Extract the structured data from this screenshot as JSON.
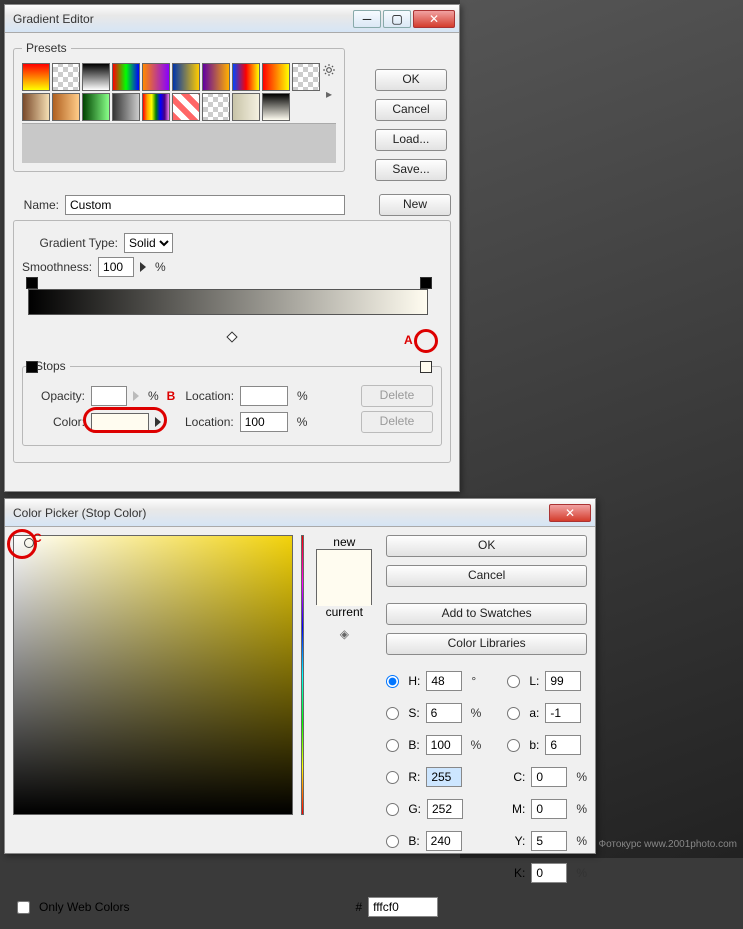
{
  "background_watermark": "Фотокурс   www.2001photo.com",
  "gradient_editor": {
    "title": "Gradient Editor",
    "presets_legend": "Presets",
    "ok": "OK",
    "cancel": "Cancel",
    "load": "Load...",
    "save": "Save...",
    "name_label": "Name:",
    "name_value": "Custom",
    "new_btn": "New",
    "gradient_type_label": "Gradient Type:",
    "gradient_type_value": "Solid",
    "smoothness_label": "Smoothness:",
    "smoothness_value": "100",
    "percent": "%",
    "stops_legend": "Stops",
    "opacity_label": "Opacity:",
    "opacity_value": "",
    "location_label": "Location:",
    "opacity_location_value": "",
    "color_label": "Color:",
    "color_swatch": "#fffcf0",
    "color_location_value": "100",
    "delete": "Delete",
    "annot_A": "A",
    "annot_B": "B"
  },
  "color_picker": {
    "title": "Color Picker (Stop Color)",
    "ok": "OK",
    "cancel": "Cancel",
    "add_to_swatches": "Add to Swatches",
    "color_libraries": "Color Libraries",
    "new_label": "new",
    "current_label": "current",
    "new_color": "#fffcf0",
    "current_color": "#fffcf0",
    "only_web": "Only Web Colors",
    "H_label": "H:",
    "H_value": "48",
    "H_unit": "°",
    "S_label": "S:",
    "S_value": "6",
    "S_unit": "%",
    "Bhsb_label": "B:",
    "Bhsb_value": "100",
    "Bhsb_unit": "%",
    "R_label": "R:",
    "R_value": "255",
    "G_label": "G:",
    "G_value": "252",
    "Brgb_label": "B:",
    "Brgb_value": "240",
    "L_label": "L:",
    "L_value": "99",
    "a_label": "a:",
    "a_value": "-1",
    "b_label": "b:",
    "b_value": "6",
    "C_label": "C:",
    "C_value": "0",
    "pct": "%",
    "M_label": "M:",
    "M_value": "0",
    "Y_label": "Y:",
    "Y_value": "5",
    "K_label": "K:",
    "K_value": "0",
    "hex_label": "#",
    "hex_value": "fffcf0",
    "annot_C": "C"
  }
}
